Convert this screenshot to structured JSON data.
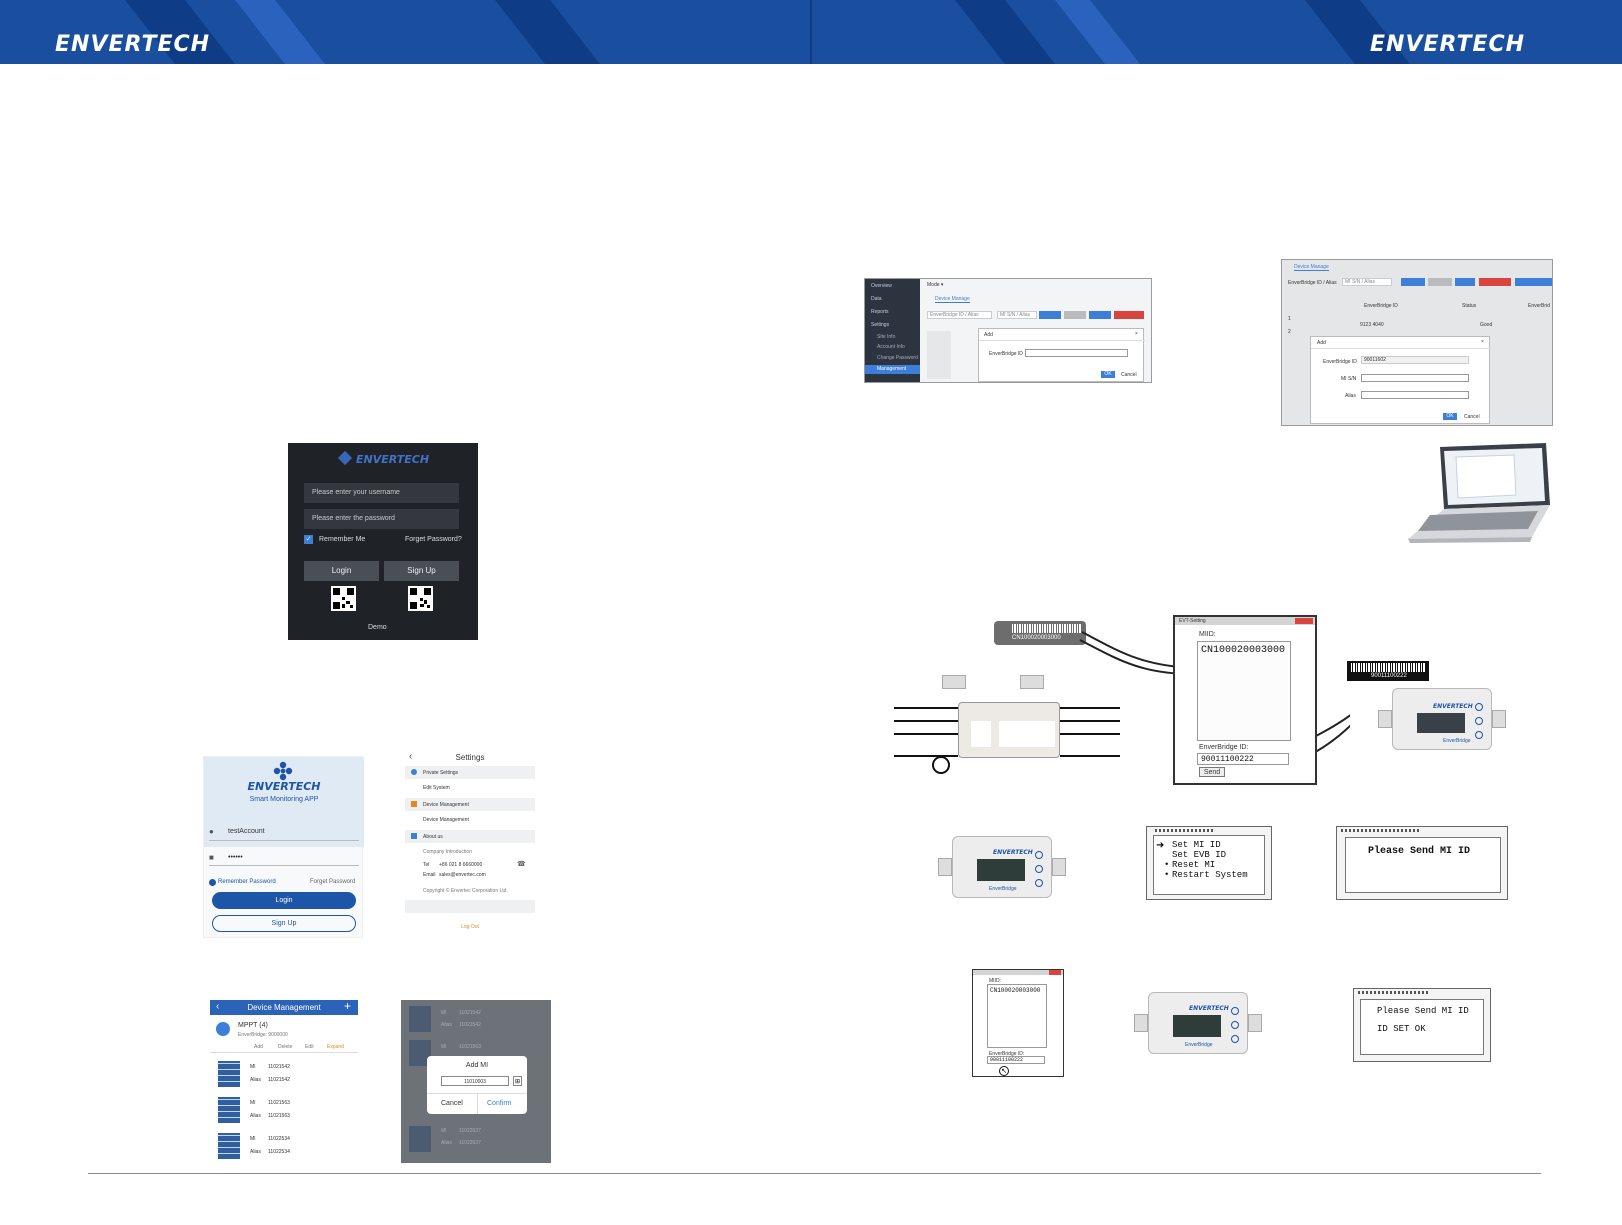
{
  "brand": {
    "logo_left": "ENVERTECH",
    "logo_right": "ENVERTECH",
    "header_color": "#1a4fa0"
  },
  "web_add_dialog": {
    "sidebar": [
      "Overview",
      "Data",
      "Reports",
      "Settings",
      "Site Info",
      "Account Info",
      "Change Password",
      "Management"
    ],
    "top_select": "Mode ▾",
    "tab": "Device Manage",
    "search_placeholder": "EnverBridge ID / Alias",
    "search_placeholder2": "MI S/N / Alias",
    "dialog_title": "Add",
    "field_label": "EnverBridge ID",
    "ok": "OK",
    "cancel": "Cancel"
  },
  "web_add_mi_dialog": {
    "tab": "Device Manage",
    "search_label": "EnverBridge ID / Alias",
    "search_label2": "MI S/N / Alias",
    "col_id": "EnverBridge ID",
    "col_status": "Status",
    "col_more": "EnverBrid",
    "row1": "1",
    "row1_id": "9123 4040",
    "row1_status": "Good",
    "row2": "2",
    "dialog_title": "Add",
    "f1_label": "EnverBridge ID",
    "f1_value": "90011602",
    "f2_label": "MI S/N",
    "f3_label": "Alias",
    "ok": "OK",
    "cancel": "Cancel"
  },
  "login_dark": {
    "logo": "ENVERTECH",
    "username_placeholder": "Please enter your username",
    "password_placeholder": "Please enter the password",
    "remember": "Remember Me",
    "forgot": "Forget Password?",
    "login": "Login",
    "signup": "Sign Up",
    "demo": "Demo"
  },
  "app_login": {
    "logo": "ENVERTECH",
    "subtitle": "Smart Monitoring APP",
    "username": "testAccount",
    "password": "••••••",
    "remember": "Remember Password",
    "forgot": "Forget Password",
    "login": "Login",
    "signup": "Sign Up"
  },
  "app_settings": {
    "title": "Settings",
    "section1": "Private Settings",
    "item1": "Edit System",
    "section2": "Device Management",
    "item2": "Device Management",
    "section3": "About us",
    "item3": "Company Introduction",
    "tel_label": "Tel",
    "tel": "+86 021 8 6660000",
    "email_label": "Email",
    "email": "sales@envertec.com",
    "copyright": "Copyright © Envertec Corporation Ltd.",
    "logout": "Log Out"
  },
  "app_devices": {
    "title": "Device Management",
    "plus": "+",
    "group": "MPPT (4)",
    "group_sub": "EnverBridge: 9000000",
    "add": "Add",
    "delete": "Delete",
    "edit": "Edit",
    "expand": "Expand",
    "mi_label": "MI",
    "alias_label": "Alias",
    "rows": [
      {
        "mi": "11021542",
        "alias": "11021542"
      },
      {
        "mi": "11021563",
        "alias": "11021563"
      },
      {
        "mi": "11022534",
        "alias": "11022534"
      }
    ]
  },
  "app_add_mi": {
    "title": "Add MI",
    "value": "11010003",
    "cancel": "Cancel",
    "confirm": "Confirm",
    "bg_rows": [
      {
        "mi": "11021542",
        "alias": "11021542"
      },
      {
        "mi": "11021563",
        "alias": "11021563"
      },
      {
        "mi": "11022534",
        "alias": "11022534"
      },
      {
        "mi": "11022637",
        "alias": "11022637"
      }
    ]
  },
  "setting_tool": {
    "window_title": "EVT-Setting",
    "miid_label": "MIID:",
    "miid_value": "CN100020003000",
    "eb_label": "EnverBridge ID:",
    "eb_value": "90011100222",
    "send": "Send"
  },
  "barcode_left": {
    "value": "CN100020003000"
  },
  "barcode_right": {
    "value": "90011100222"
  },
  "enverbridge_unit": {
    "brand": "ENVERTECH",
    "name": "EnverBridge"
  },
  "lcd_menu": {
    "lines": [
      "Set MI ID",
      "Set EVB ID",
      "Reset MI",
      "Restart System"
    ]
  },
  "lcd_send": {
    "text": "Please Send MI ID"
  },
  "setting_tool_small": {
    "miid_label": "MIID:",
    "miid_value": "CN100020003000",
    "eb_label": "EnverBridge ID:",
    "eb_value": "90011100222"
  },
  "lcd_ok": {
    "line1": "Please Send MI ID",
    "line2": "ID SET OK"
  }
}
